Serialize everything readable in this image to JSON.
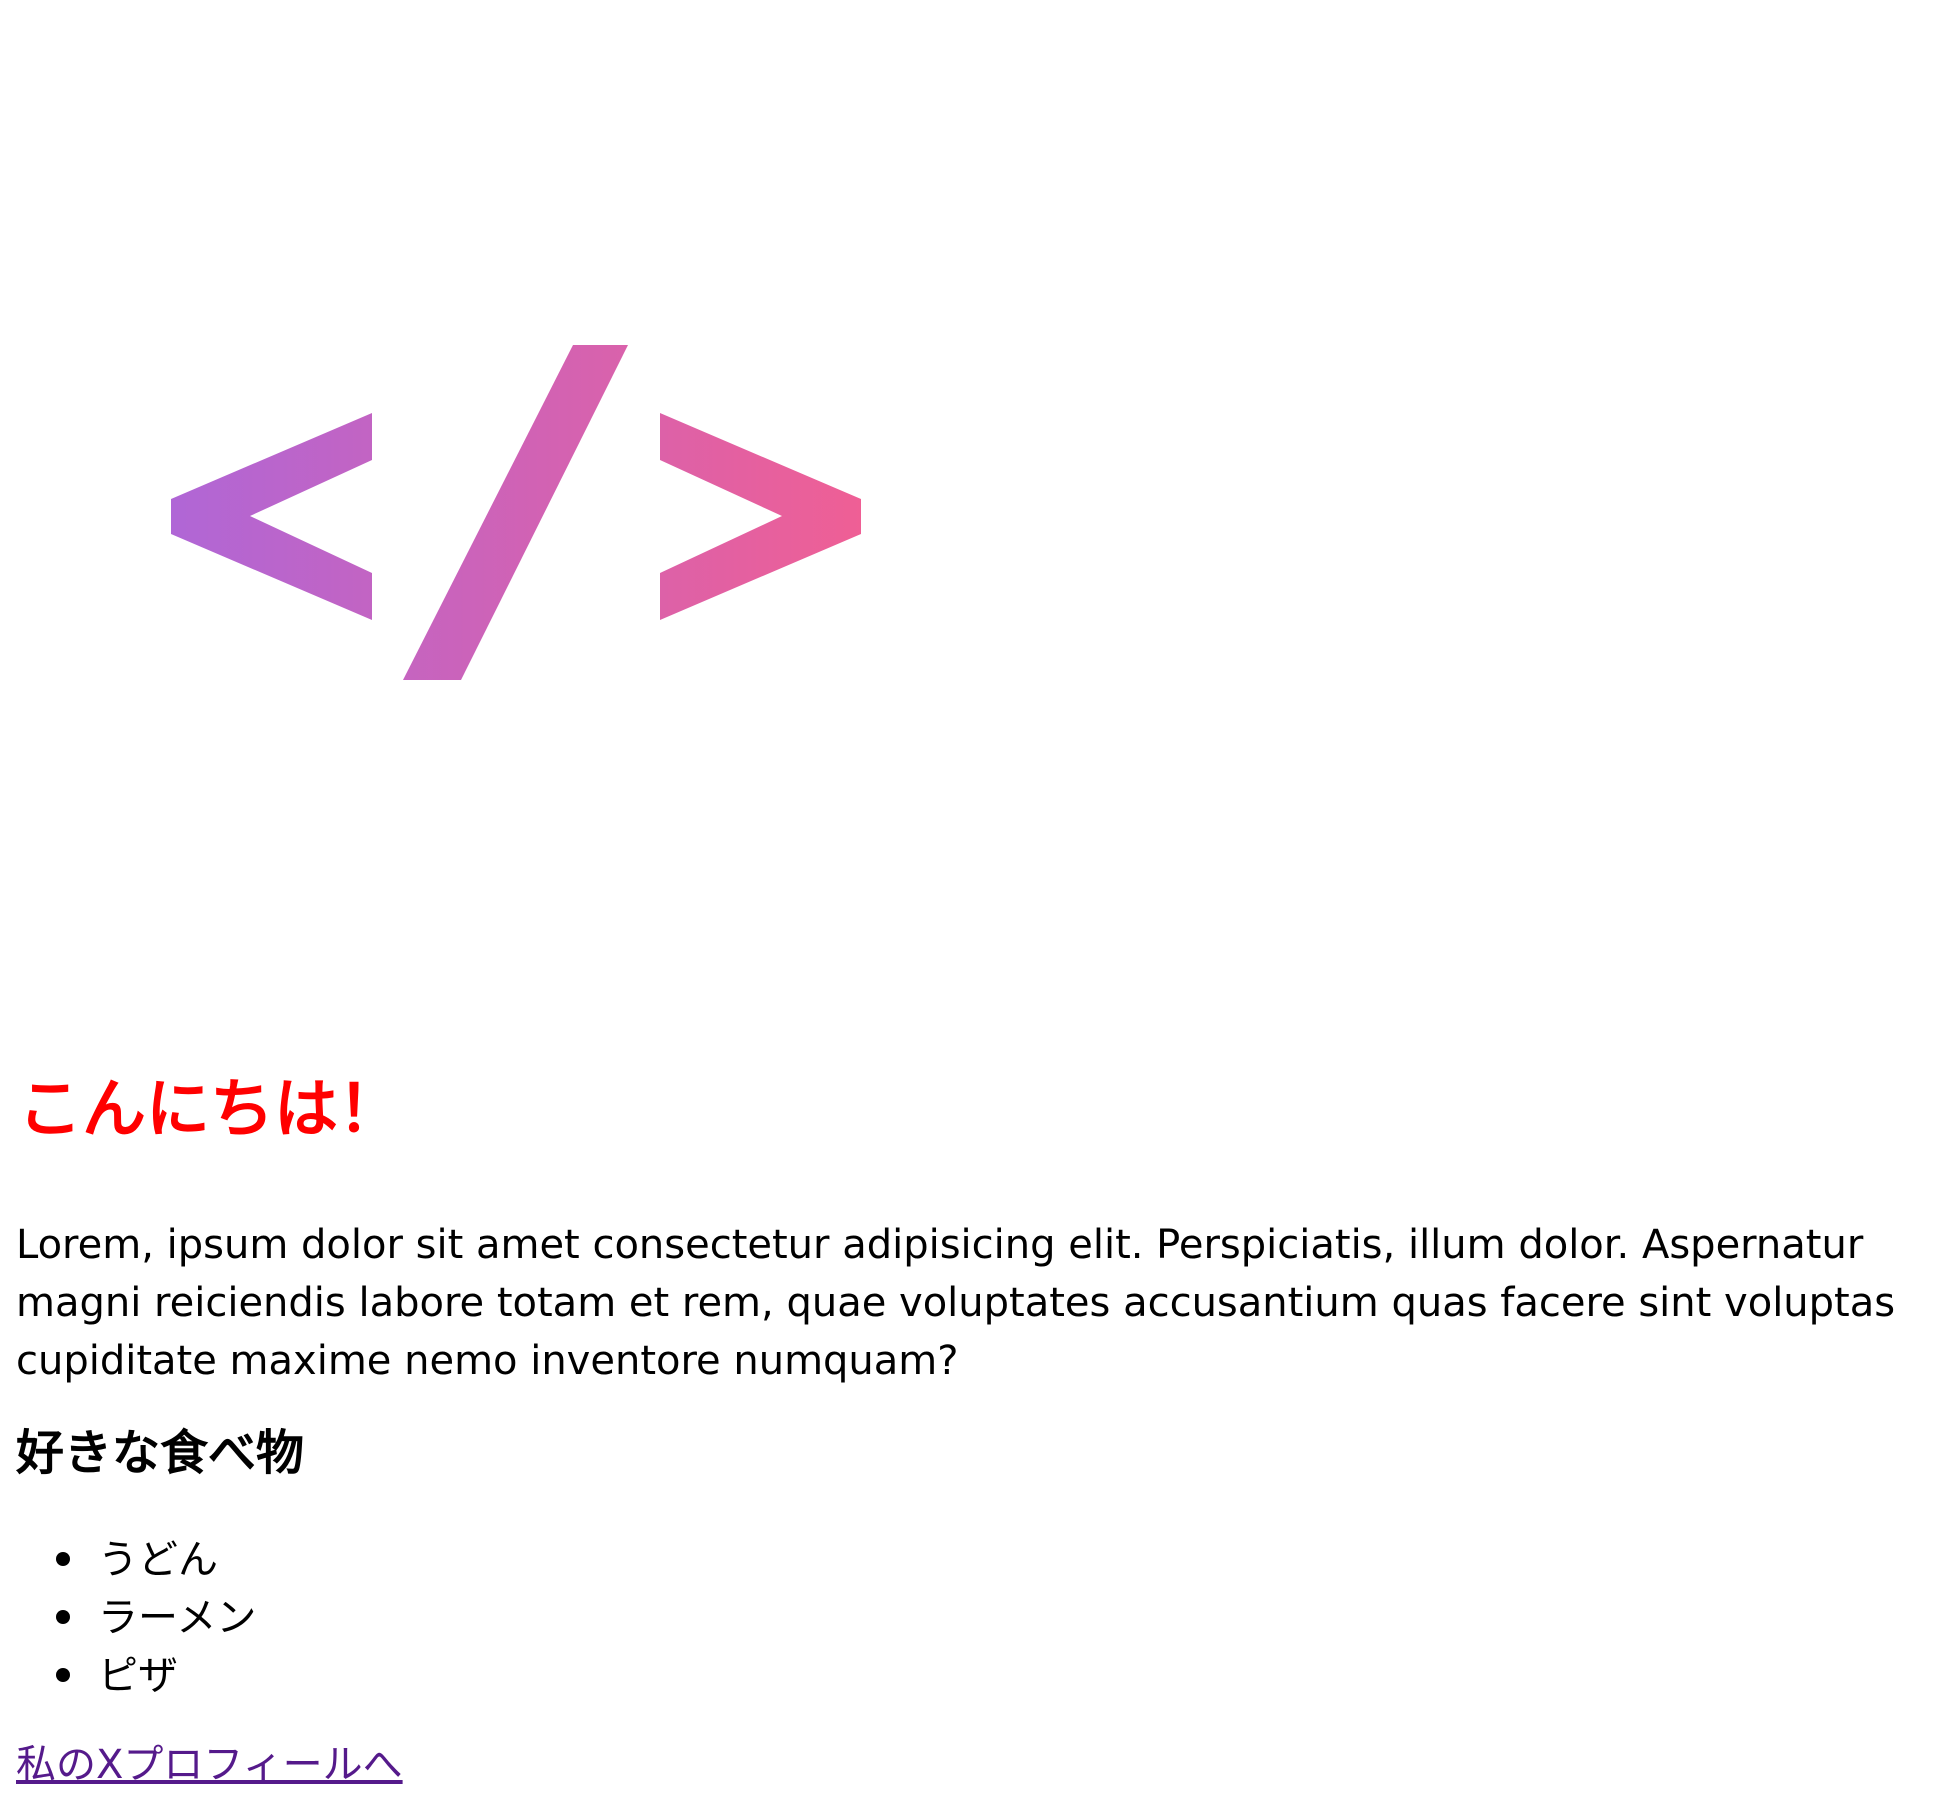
{
  "logo": {
    "icon": "code-brackets-icon",
    "gradient_start": "#b066d6",
    "gradient_end": "#ef5f95"
  },
  "heading": {
    "text": "こんにちは！",
    "color": "#ff0000"
  },
  "paragraph": "Lorem, ipsum dolor sit amet consectetur adipisicing elit. Perspiciatis, illum dolor. Aspernatur magni reiciendis labore totam et rem, quae voluptates accusantium quas facere sint voluptas cupiditate maxime nemo inventore numquam?",
  "favorite_foods": {
    "title": "好きな食べ物",
    "items": [
      "うどん",
      "ラーメン",
      "ピザ"
    ]
  },
  "profile_link": {
    "text": "私のXプロフィールへ",
    "color": "#551a8b"
  }
}
